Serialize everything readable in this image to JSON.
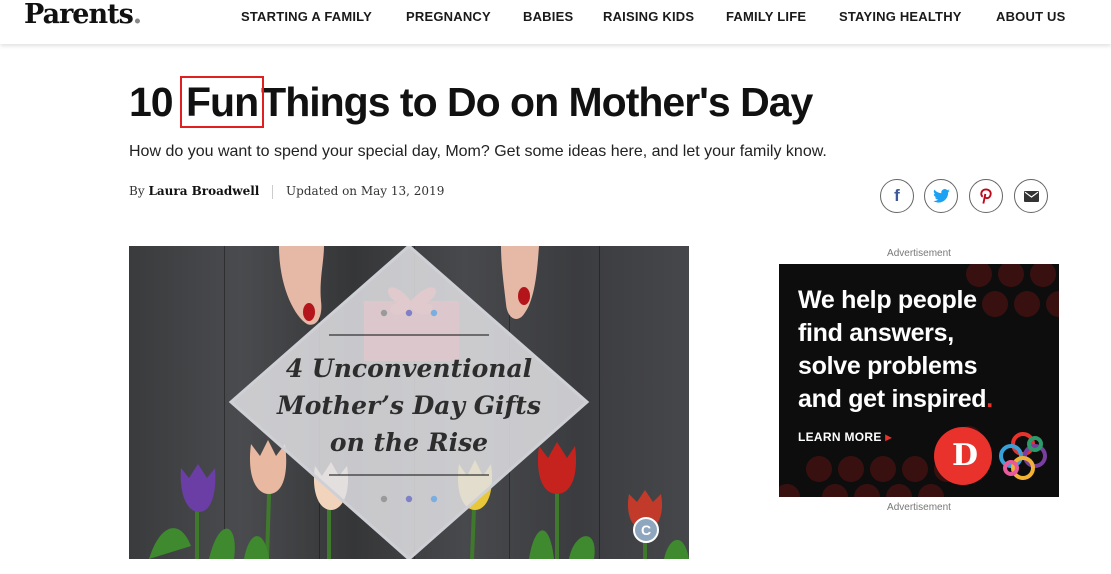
{
  "header": {
    "logo": "Parents",
    "logo_dot": ".",
    "nav": [
      "STARTING A FAMILY",
      "PREGNANCY",
      "BABIES",
      "RAISING KIDS",
      "FAMILY LIFE",
      "STAYING HEALTHY",
      "ABOUT US"
    ]
  },
  "article": {
    "title_before": "10",
    "title_highlight": "Fun",
    "title_after": "Things to Do on Mother's Day",
    "subtitle": "How do you want to spend your special day, Mom? Get some ideas here, and let your family know.",
    "byline_prefix": "By",
    "author": "Laura Broadwell",
    "updated": "Updated on May 13, 2019"
  },
  "share": {
    "icons": [
      "facebook-icon",
      "twitter-icon",
      "pinterest-icon",
      "email-icon"
    ],
    "colors": {
      "facebook": "#3b5998",
      "twitter": "#1da1f2",
      "pinterest": "#bd081c",
      "email": "#333333"
    }
  },
  "hero": {
    "overlay_line1": "4 Unconventional",
    "overlay_line2": "Mother’s Day Gifts",
    "overlay_line3": "on the Rise",
    "badge": "C"
  },
  "ad": {
    "label_top": "Advertisement",
    "label_bottom": "Advertisement",
    "line1": "We help people",
    "line2": "find answers,",
    "line3": "solve problems",
    "line4": "and get inspired",
    "line4_dot": ".",
    "cta": "LEARN MORE",
    "cta_arrow": "▸",
    "brand_letter": "D",
    "accent": "#e8322b"
  }
}
